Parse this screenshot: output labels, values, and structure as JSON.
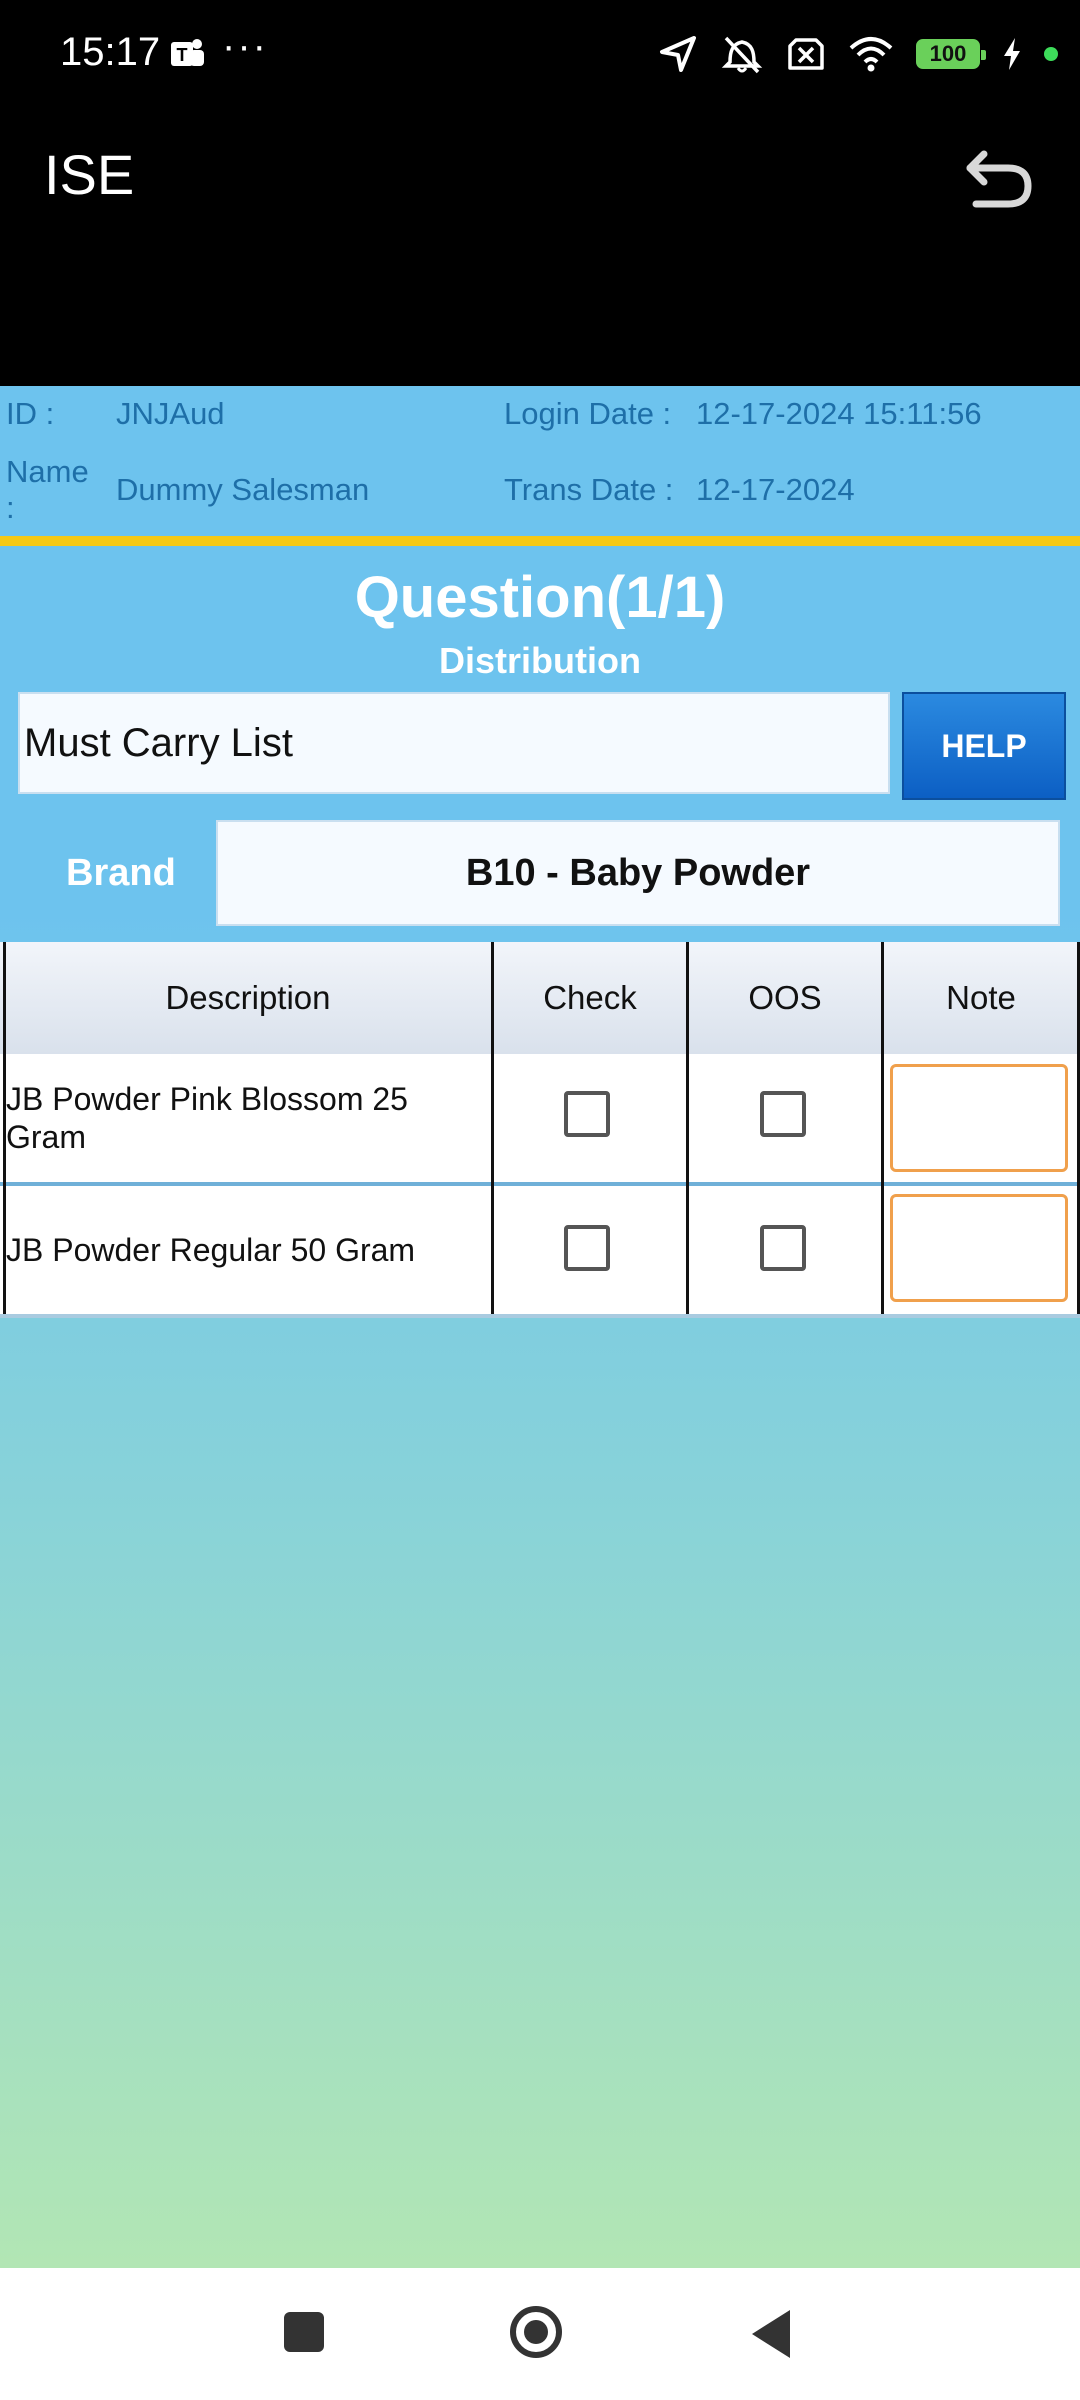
{
  "status_bar": {
    "time": "15:17",
    "more": "···",
    "battery": "100",
    "icons": [
      "teams-icon",
      "navigation-icon",
      "vibrate-off-icon",
      "no-sim-icon",
      "wifi-icon",
      "battery-icon",
      "charging-icon"
    ]
  },
  "header": {
    "title": "ISE",
    "back_icon": "undo-icon"
  },
  "info": {
    "id_label": "ID :",
    "id_value": "JNJAud",
    "name_label_1": "Name",
    "name_label_2": ":",
    "name_value": "Dummy Salesman",
    "login_label": "Login Date :",
    "login_value": "12-17-2024 15:11:56",
    "trans_label": "Trans Date :",
    "trans_value": "12-17-2024"
  },
  "question": {
    "title": "Question(1/1)",
    "subtitle": "Distribution"
  },
  "list_box": {
    "value": "Must Carry List"
  },
  "help_button": {
    "label": "HELP"
  },
  "brand": {
    "label": "Brand",
    "value": "B10 - Baby Powder"
  },
  "table": {
    "headers": [
      "Description",
      "Check",
      "OOS",
      "Note"
    ],
    "rows": [
      {
        "description": "JB Powder Pink Blossom 25 Gram",
        "check": false,
        "oos": false,
        "note": ""
      },
      {
        "description": "JB Powder Regular 50 Gram",
        "check": false,
        "oos": false,
        "note": ""
      }
    ]
  },
  "colors": {
    "accent": "#6dc3ee",
    "divider": "#f6c915",
    "help": "#1a74d2",
    "note_border": "#f0a04c"
  }
}
